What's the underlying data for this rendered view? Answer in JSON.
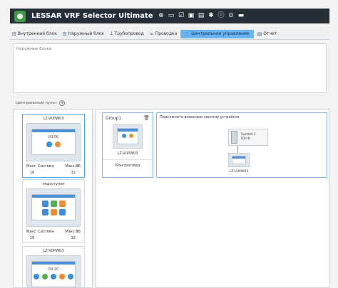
{
  "titlebar": {
    "title": "LESSAR VRF Selector Ultimate",
    "icons": [
      "plus-circle-icon",
      "folder-icon",
      "edit-icon",
      "save-icon",
      "list-icon",
      "gear-icon",
      "info-icon",
      "help-icon",
      "export-icon"
    ],
    "colors": {
      "background": "#252d36",
      "logo": "#3f9a4a"
    }
  },
  "tabs": [
    {
      "label": "Внутренний блок",
      "icon": "indoor-unit-icon"
    },
    {
      "label": "Наружный блок",
      "icon": "outdoor-unit-icon"
    },
    {
      "label": "Трубопровод",
      "icon": "pipe-icon"
    },
    {
      "label": "Проводка",
      "icon": "wiring-icon"
    },
    {
      "label": "Центральное управление",
      "icon": "central-control-icon",
      "active": true
    },
    {
      "label": "Отчет",
      "icon": "report-icon"
    }
  ],
  "outdoor_panel": {
    "title": "Наружные блоки"
  },
  "central_panel": {
    "label": "Центральный пульт"
  },
  "sidebar_cards": [
    {
      "title": "LZ-VUPW03",
      "time": "00:00",
      "stat_label_1": "Макс. Система",
      "stat_label_2": "Макс.ВБ",
      "stat_value_1": "16",
      "stat_value_2": "32",
      "selected": true
    },
    {
      "title": "недоступен",
      "stat_label_1": "Макс. Система",
      "stat_label_2": "Макс.ВБ",
      "stat_value_1": "16",
      "stat_value_2": "32",
      "selected": false
    },
    {
      "title": "LZ-VUPW03",
      "time": "09:20",
      "selected": false
    }
  ],
  "group": {
    "name": "Group1",
    "controller_model": "LZ-VUPW03",
    "controller_type": "Контроллер"
  },
  "external_system": {
    "title": "Подключите внешнюю систему устройств",
    "system_name": "System 1",
    "system_sub": "IDU:8",
    "node_name": "LZ-VUPW03"
  },
  "accent_color": "#6ab4f1"
}
